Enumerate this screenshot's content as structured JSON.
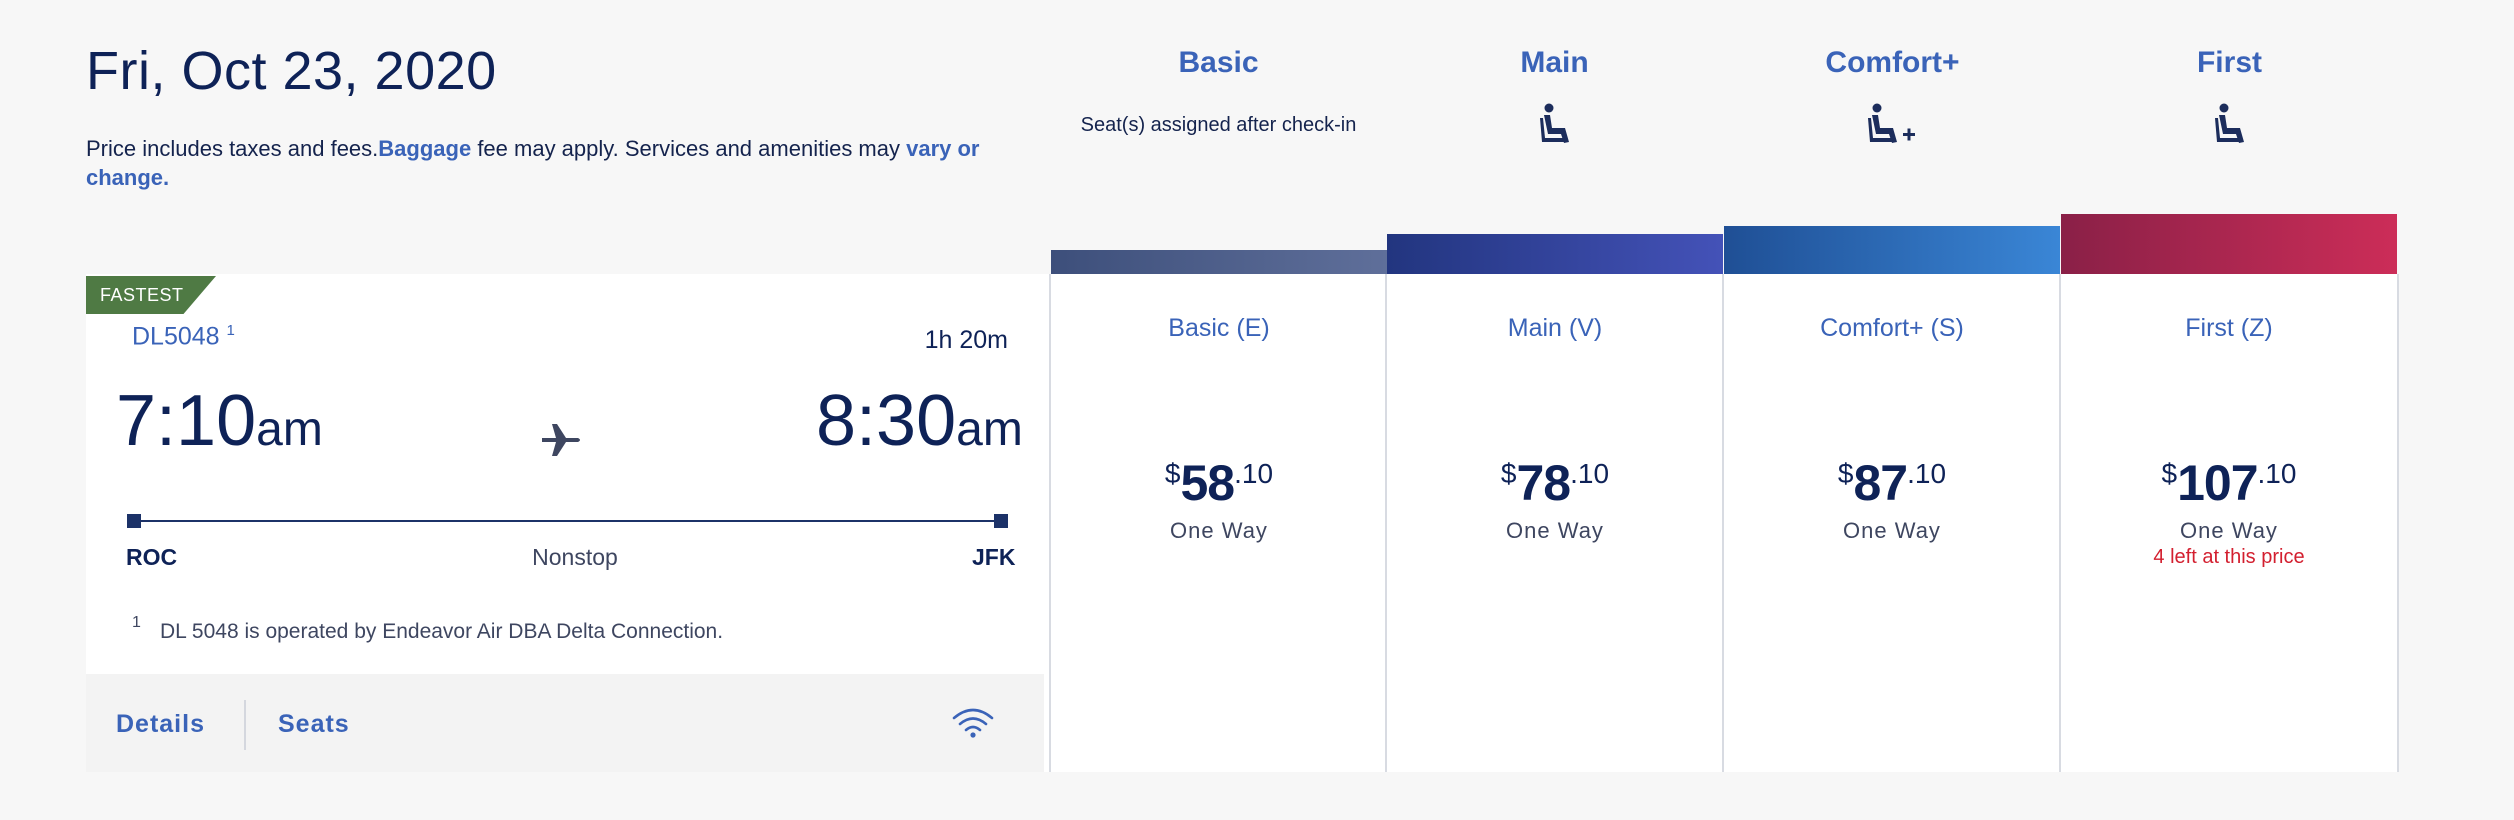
{
  "header": {
    "date": "Fri, Oct 23, 2020",
    "note_prefix": "Price includes taxes and fees.",
    "baggage_link": "Baggage",
    "note_middle": " fee may apply. Services and amenities may ",
    "vary_link": "vary or change."
  },
  "cabins": [
    {
      "name": "Basic",
      "subtitle": "Seat(s) assigned after check-in",
      "icon": "none"
    },
    {
      "name": "Main",
      "icon": "seat-icon"
    },
    {
      "name": "Comfort+",
      "icon": "seat-plus-icon"
    },
    {
      "name": "First",
      "icon": "seat-icon"
    }
  ],
  "flight": {
    "badge": "FASTEST",
    "number": "DL5048",
    "footnote_ref": "1",
    "duration": "1h 20m",
    "depart_time": "7:10",
    "depart_ampm": "am",
    "arrive_time": "8:30",
    "arrive_ampm": "am",
    "origin": "ROC",
    "destination": "JFK",
    "stops": "Nonstop",
    "footnote_num": "1",
    "footnote": "DL 5048 is operated by Endeavor Air DBA Delta Connection.",
    "details_label": "Details",
    "seats_label": "Seats",
    "wifi_icon": "wifi-icon"
  },
  "fares": [
    {
      "name": "Basic (E)",
      "currency": "$",
      "dollars": "58",
      "cents": ".10",
      "trip": "One Way",
      "note": "",
      "bar_color": "#4a5b86"
    },
    {
      "name": "Main (V)",
      "currency": "$",
      "dollars": "78",
      "cents": ".10",
      "trip": "One Way",
      "note": "",
      "bar_color": "#2d3f9a"
    },
    {
      "name": "Comfort+ (S)",
      "currency": "$",
      "dollars": "87",
      "cents": ".10",
      "trip": "One Way",
      "note": "",
      "bar_color": "#2a64b0"
    },
    {
      "name": "First (Z)",
      "currency": "$",
      "dollars": "107",
      "cents": ".10",
      "trip": "One Way",
      "note": "4 left at this price",
      "bar_color": "#b0264f"
    }
  ],
  "colors": {
    "accent": "#3a63b8",
    "navy": "#0e2257",
    "badge_green": "#4f7a44",
    "alert_red": "#d31f2f"
  }
}
